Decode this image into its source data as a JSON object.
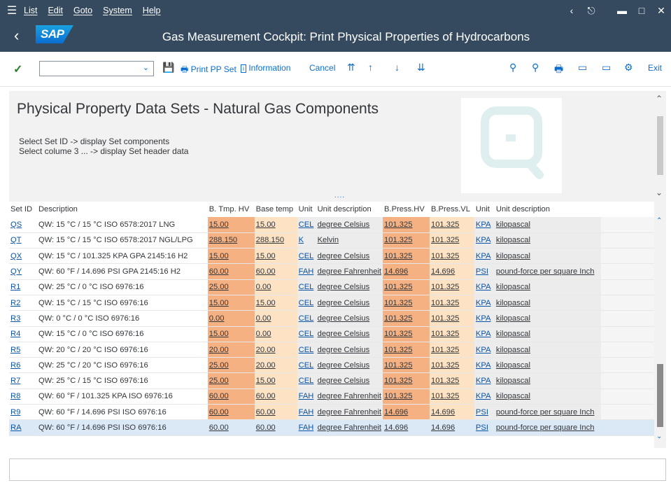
{
  "menubar": {
    "items": [
      "List",
      "Edit",
      "Goto",
      "System",
      "Help"
    ]
  },
  "titlebar": {
    "logo_text": "SAP",
    "title": "Gas Measurement Cockpit: Print Physical Properties of Hydrocarbons"
  },
  "toolbar": {
    "print_pp_set": "Print PP Set",
    "information": "Information",
    "cancel": "Cancel",
    "exit": "Exit"
  },
  "header": {
    "heading": "Physical Property Data Sets - Natural Gas Components",
    "line1": "Select Set ID -> display Set components",
    "line2": "Select colume 3 ... -> display Set header data",
    "dots": "...."
  },
  "table": {
    "columns": [
      "Set ID",
      "Description",
      "B. Tmp. HV",
      "Base temp",
      "Unit",
      "Unit description",
      "B.Press.HV",
      "B.Press.VL",
      "Unit",
      "Unit description"
    ],
    "rows": [
      [
        "QS",
        "QW: 15 °C / 15 °C ISO 6578:2017 LNG",
        "15.00",
        "15.00",
        "CEL",
        "degree Celsius",
        "101.325",
        "101.325",
        "KPA",
        "kilopascal"
      ],
      [
        "QT",
        "QW: 15 °C / 15 °C ISO 6578:2017 NGL/LPG",
        "288.150",
        "288.150",
        "K",
        "Kelvin",
        "101.325",
        "101.325",
        "KPA",
        "kilopascal"
      ],
      [
        "QX",
        "QW: 15 °C / 101.325 KPA GPA 2145:16 H2",
        "15.00",
        "15.00",
        "CEL",
        "degree Celsius",
        "101.325",
        "101.325",
        "KPA",
        "kilopascal"
      ],
      [
        "QY",
        "QW: 60 °F / 14.696 PSI GPA 2145:16 H2",
        "60.00",
        "60.00",
        "FAH",
        "degree Fahrenheit",
        "14.696",
        "14.696",
        "PSI",
        "pound-force per square Inch"
      ],
      [
        "R1",
        "QW: 25 °C / 0 °C ISO 6976:16",
        "25.00",
        "0.00",
        "CEL",
        "degree Celsius",
        "101.325",
        "101.325",
        "KPA",
        "kilopascal"
      ],
      [
        "R2",
        "QW: 15 °C / 15 °C ISO 6976:16",
        "15.00",
        "15.00",
        "CEL",
        "degree Celsius",
        "101.325",
        "101.325",
        "KPA",
        "kilopascal"
      ],
      [
        "R3",
        "QW: 0 °C / 0 °C ISO 6976:16",
        "0.00",
        "0.00",
        "CEL",
        "degree Celsius",
        "101.325",
        "101.325",
        "KPA",
        "kilopascal"
      ],
      [
        "R4",
        "QW: 15 °C / 0 °C ISO 6976:16",
        "15.00",
        "0.00",
        "CEL",
        "degree Celsius",
        "101.325",
        "101.325",
        "KPA",
        "kilopascal"
      ],
      [
        "R5",
        "QW: 20 °C / 20 °C ISO 6976:16",
        "20.00",
        "20.00",
        "CEL",
        "degree Celsius",
        "101.325",
        "101.325",
        "KPA",
        "kilopascal"
      ],
      [
        "R6",
        "QW: 25 °C / 20 °C ISO 6976:16",
        "25.00",
        "20.00",
        "CEL",
        "degree Celsius",
        "101.325",
        "101.325",
        "KPA",
        "kilopascal"
      ],
      [
        "R7",
        "QW: 25 °C / 15 °C ISO 6976:16",
        "25.00",
        "15.00",
        "CEL",
        "degree Celsius",
        "101.325",
        "101.325",
        "KPA",
        "kilopascal"
      ],
      [
        "R8",
        "QW: 60 °F / 101.325 KPA ISO 6976:16",
        "60.00",
        "60.00",
        "FAH",
        "degree Fahrenheit",
        "101.325",
        "101.325",
        "KPA",
        "kilopascal"
      ],
      [
        "R9",
        "QW: 60 °F / 14.696 PSI ISO 6976:16",
        "60.00",
        "60.00",
        "FAH",
        "degree Fahrenheit",
        "14.696",
        "14.696",
        "PSI",
        "pound-force per square Inch"
      ],
      [
        "RA",
        "QW: 60 °F / 14.696 PSI ISO 6976:16",
        "60.00",
        "60.00",
        "FAH",
        "degree Fahrenheit",
        "14.696",
        "14.696",
        "PSI",
        "pound-force per square Inch"
      ]
    ],
    "selected_row": 13
  },
  "colors": {
    "shell": "#354a5f",
    "accent": "#0a6ed1",
    "hv_column": "#f6b183",
    "light_column": "#fde3c4",
    "selected_row": "#dbe8f6"
  },
  "icons": [
    "menu-icon",
    "back-icon",
    "check-icon",
    "save-icon",
    "print-icon",
    "info-icon",
    "first-page-icon",
    "prev-page-icon",
    "next-page-icon",
    "last-page-icon",
    "find-icon",
    "find-next-icon",
    "print-icon",
    "new-session-icon",
    "create-shortcut-icon",
    "settings-icon"
  ]
}
